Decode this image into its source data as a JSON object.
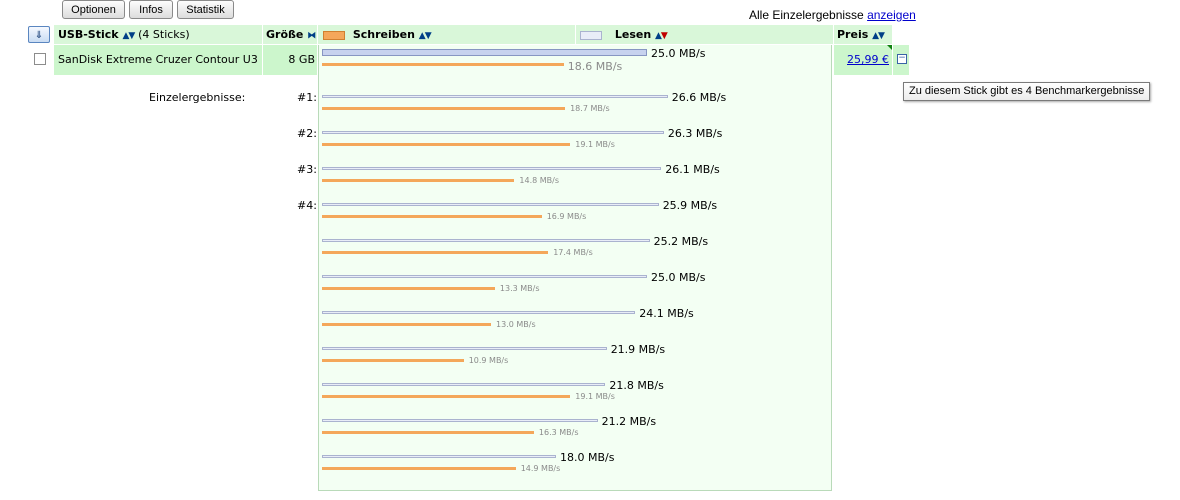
{
  "toolbar": {
    "buttons": [
      "Optionen",
      "Infos",
      "Statistik"
    ]
  },
  "top_right": {
    "text": "Alle Einzelergebnisse",
    "link": "anzeigen"
  },
  "columns": {
    "stick": "USB-Stick",
    "stick_count": "(4 Sticks)",
    "size": "Größe",
    "write": "Schreiben",
    "read": "Lesen",
    "price": "Preis"
  },
  "product": {
    "name": "SanDisk Extreme Cruzer Contour U3",
    "size": "8 GB",
    "read_label": "25.0 MB/s",
    "write_label": "18.6 MB/s",
    "read_value": 25.0,
    "write_value": 18.6,
    "price": "25,99 €"
  },
  "single_results": {
    "label": "Einzelergebnisse:",
    "indices": [
      "#1:",
      "#2:",
      "#3:",
      "#4:"
    ],
    "items": [
      {
        "read": 26.6,
        "write": 18.7,
        "read_label": "26.6 MB/s",
        "write_label": "18.7 MB/s"
      },
      {
        "read": 26.3,
        "write": 19.1,
        "read_label": "26.3 MB/s",
        "write_label": "19.1 MB/s"
      },
      {
        "read": 26.1,
        "write": 14.8,
        "read_label": "26.1 MB/s",
        "write_label": "14.8 MB/s"
      },
      {
        "read": 25.9,
        "write": 16.9,
        "read_label": "25.9 MB/s",
        "write_label": "16.9 MB/s"
      },
      {
        "read": 25.2,
        "write": 17.4,
        "read_label": "25.2 MB/s",
        "write_label": "17.4 MB/s"
      },
      {
        "read": 25.0,
        "write": 13.3,
        "read_label": "25.0 MB/s",
        "write_label": "13.3 MB/s"
      },
      {
        "read": 24.1,
        "write": 13.0,
        "read_label": "24.1 MB/s",
        "write_label": "13.0 MB/s"
      },
      {
        "read": 21.9,
        "write": 10.9,
        "read_label": "21.9 MB/s",
        "write_label": "10.9 MB/s"
      },
      {
        "read": 21.8,
        "write": 19.1,
        "read_label": "21.8 MB/s",
        "write_label": "19.1 MB/s"
      },
      {
        "read": 21.2,
        "write": 16.3,
        "read_label": "21.2 MB/s",
        "write_label": "16.3 MB/s"
      },
      {
        "read": 18.0,
        "write": 14.9,
        "read_label": "18.0 MB/s",
        "write_label": "14.9 MB/s"
      }
    ]
  },
  "tooltip": "Zu diesem Stick gibt es 4 Benchmarkergebnisse",
  "icons": {
    "sort_toggle": "down-arrow-icon",
    "size_sort": "sort-bidirectional-icon",
    "collapse": "minus-box-icon"
  },
  "colors": {
    "header_green": "#d9f7d9",
    "row_green": "#ccf6cc",
    "write_bar": "#f4a75a",
    "read_bar": "#e9edf8",
    "link": "#0000cc"
  }
}
